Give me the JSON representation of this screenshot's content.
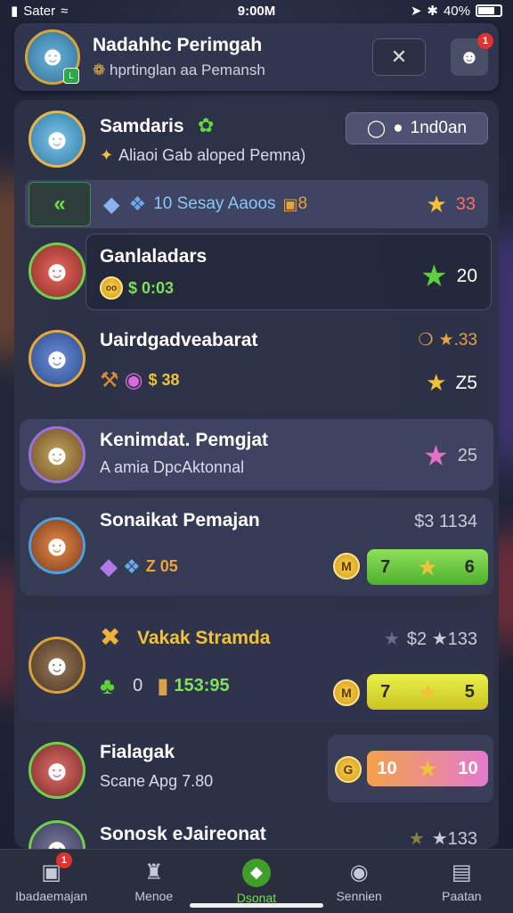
{
  "status": {
    "carrier": "Sater",
    "time": "9:00M",
    "battery": "40%"
  },
  "header": {
    "title": "Nadahhc Perimgah",
    "subtitle": "hprtinglan aa Pemansh",
    "close_icon": "close-icon",
    "profile_badge": "1"
  },
  "rows": [
    {
      "name": "Samdaris",
      "sub": "Aliaoi Gab aloped Pemna)",
      "action": "1nd0an",
      "bar_text": "10 Sesay Aaoos",
      "bar_extra": "8",
      "score": "33"
    },
    {
      "name": "Ganlaladars",
      "sub": "$ 0:03",
      "score": "20"
    },
    {
      "name": "Uairdgadveabarat",
      "sub": "$ 38",
      "top_score": "★.33",
      "score": "Z5"
    },
    {
      "name": "Kenimdat. Pemgjat",
      "sub": "A amia DpcAktonnal",
      "score": "25"
    },
    {
      "name": "Sonaikat Pemajan",
      "sub": "Z 05",
      "top_score": "$3 1134",
      "coin": "M",
      "pill": [
        "7",
        "6"
      ]
    },
    {
      "name": "Vakak Stramda",
      "sub_a": "0",
      "sub_b": "153:95",
      "top_score": "$2 ★133",
      "coin": "M",
      "pill": [
        "7",
        "5"
      ]
    },
    {
      "name": "Fialagak",
      "sub": "Scane Apg 7.80",
      "coin": "G",
      "pill": [
        "10",
        "10"
      ]
    },
    {
      "name": "Sonosk eJaireonat",
      "top_score": "★133"
    }
  ],
  "nav": [
    {
      "label": "Ibadaemajan",
      "icon": "lock-icon",
      "badge": "1"
    },
    {
      "label": "Menoe",
      "icon": "tower-icon"
    },
    {
      "label": "Dsonat",
      "icon": "gem-icon"
    },
    {
      "label": "Sennien",
      "icon": "camera-icon"
    },
    {
      "label": "Paatan",
      "icon": "box-icon"
    }
  ]
}
